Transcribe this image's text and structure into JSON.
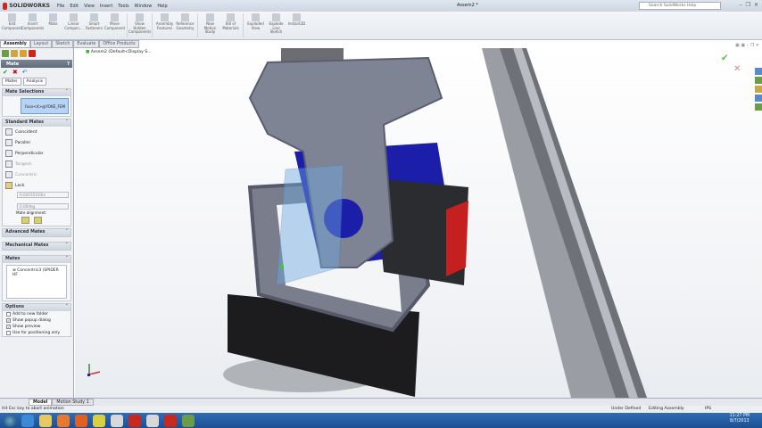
{
  "app": {
    "brand": "SOLIDWORKS",
    "doc_title": "Assem2 *",
    "search_placeholder": "Search SolidWorks Help",
    "menu": [
      "File",
      "Edit",
      "View",
      "Insert",
      "Tools",
      "Window",
      "Help"
    ]
  },
  "commands": [
    "Edit Component",
    "Insert Components",
    "Mate",
    "Linear Compon...",
    "Smart Fasteners",
    "Move Component",
    "Show Hidden Components",
    "Assembly Features",
    "Reference Geometry",
    "New Motion Study",
    "Bill of Materials",
    "Exploded View",
    "Explode Line Sketch",
    "Instant3D"
  ],
  "tabs": [
    "Assembly",
    "Layout",
    "Sketch",
    "Evaluate",
    "Office Products"
  ],
  "panel": {
    "title": "Mate",
    "help": "?",
    "subtabs": [
      "Mates",
      "Analysis"
    ],
    "mate_selections": {
      "header": "Mate Selections",
      "value": "Face<4>@YOKE_FEM"
    },
    "standard_mates": {
      "header": "Standard Mates",
      "items": [
        {
          "label": "Coincident",
          "enabled": true
        },
        {
          "label": "Parallel",
          "enabled": true
        },
        {
          "label": "Perpendicular",
          "enabled": true
        },
        {
          "label": "Tangent",
          "enabled": false
        },
        {
          "label": "Concentric",
          "enabled": false
        },
        {
          "label": "Lock",
          "enabled": true
        }
      ],
      "distance": "0.04155103in",
      "angle": "0.00deg",
      "alignment_label": "Mate alignment:"
    },
    "advanced_header": "Advanced Mates",
    "mechanical_header": "Mechanical Mates",
    "mates": {
      "header": "Mates",
      "items": [
        "Concentric3 (SPIDER HF"
      ]
    },
    "options": {
      "header": "Options",
      "items": [
        {
          "label": "Add to new folder",
          "checked": false
        },
        {
          "label": "Show popup dialog",
          "checked": true
        },
        {
          "label": "Show preview",
          "checked": true
        },
        {
          "label": "Use for positioning only",
          "checked": false
        }
      ]
    }
  },
  "tree_root": "Assem2 (Default<Display S...",
  "bottom_tabs": [
    "Model",
    "Motion Study 1"
  ],
  "status": {
    "hint": "Hit Esc key to abort animation",
    "state": "Under Defined",
    "mode": "Editing Assembly",
    "units": "IPS"
  },
  "clock": {
    "time": "11:27 PM",
    "date": "8/7/2013"
  },
  "colors": {
    "accent": "#c8281e",
    "taskbar": "#1e4f92",
    "selection": "#b8d4f4"
  }
}
